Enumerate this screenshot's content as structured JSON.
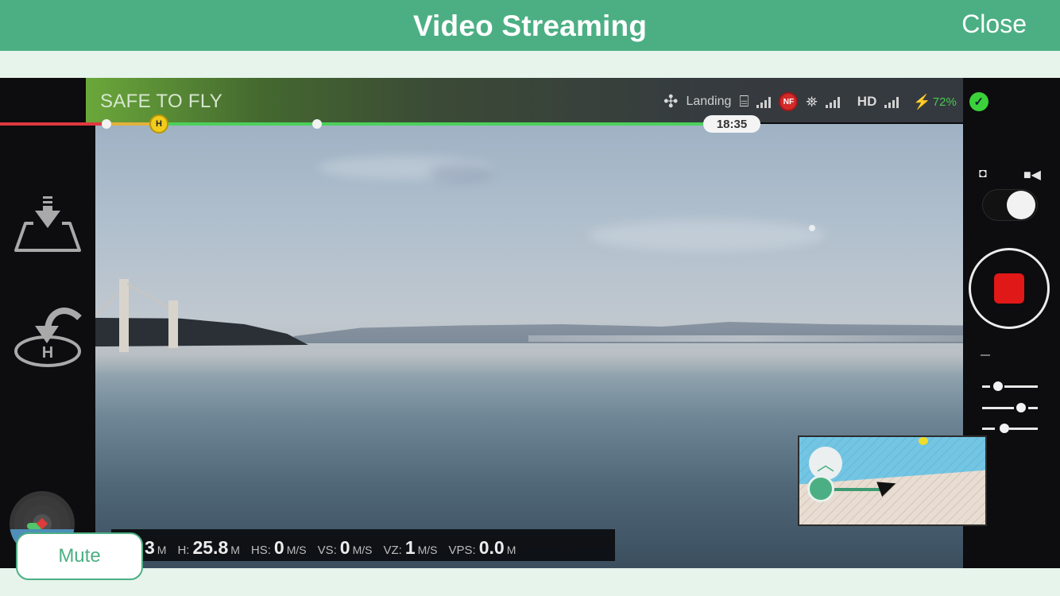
{
  "navbar": {
    "title": "Video Streaming",
    "close_label": "Close",
    "color": "#4caf84"
  },
  "hud": {
    "status_text": "SAFE TO FLY",
    "flight_mode": "Landing",
    "flight_time": "18:35",
    "battery_percent": "72%",
    "video_quality": "HD",
    "no_fly_badge": "NF",
    "home_marker": "H",
    "status_ok_color": "#3ad13a",
    "icons": [
      "drone-icon",
      "remote-controller-icon",
      "no-fly-zone-icon",
      "satellite-icon",
      "hd-signal-icon",
      "battery-icon",
      "status-ok-icon"
    ]
  },
  "left_controls": {
    "auto_takeoff_land": "landing-icon",
    "return_to_home": "return-home-icon"
  },
  "right_panel": {
    "photo_icon": "camera-icon",
    "video_icon": "video-camera-icon",
    "mode": "video",
    "record_state": "recording",
    "record_color": "#e01818",
    "settings_label": "camera-settings-icon"
  },
  "telemetry": {
    "items": [
      {
        "label": "",
        "value": "3",
        "unit": "M"
      },
      {
        "label": "H:",
        "value": "25.8",
        "unit": "M"
      },
      {
        "label": "HS:",
        "value": "0",
        "unit": "M/S"
      },
      {
        "label": "VS:",
        "value": "0",
        "unit": "M/S"
      },
      {
        "label": "VZ:",
        "value": "1",
        "unit": "M/S"
      },
      {
        "label": "VPS:",
        "value": "0.0",
        "unit": "M"
      }
    ]
  },
  "minimap": {
    "recenter_icon": "chevron-up-icon",
    "home_icon": "home-point-icon",
    "aircraft_icon": "aircraft-arrow-icon"
  },
  "footer": {
    "mute_label": "Mute"
  }
}
